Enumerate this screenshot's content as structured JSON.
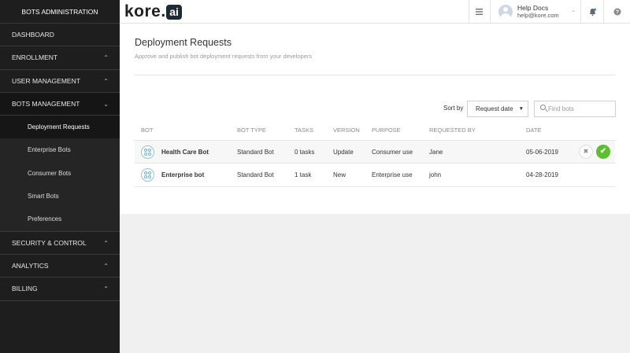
{
  "sidebar": {
    "title": "BOTS ADMINISTRATION",
    "items": [
      {
        "label": "DASHBOARD",
        "chevron": ""
      },
      {
        "label": "ENROLLMENT",
        "chevron": "^"
      },
      {
        "label": "USER MANAGEMENT",
        "chevron": "^"
      },
      {
        "label": "BOTS MANAGEMENT",
        "chevron": "v"
      },
      {
        "label": "SECURITY & CONTROL",
        "chevron": "^"
      },
      {
        "label": "ANALYTICS",
        "chevron": "^"
      },
      {
        "label": "BILLING",
        "chevron": "^"
      }
    ],
    "subitems": [
      {
        "label": "Deployment Requests"
      },
      {
        "label": "Enterprise Bots"
      },
      {
        "label": "Consumer Bots"
      },
      {
        "label": "Smart Bots"
      },
      {
        "label": "Preferences"
      }
    ]
  },
  "topbar": {
    "logo_text": "kore",
    "logo_dot": ".",
    "logo_badge": "ai",
    "menu_icon": "hamburger-icon",
    "user_name": "Help Docs",
    "user_email": "help@kore.com",
    "caret": "⌄",
    "bell_icon": "bell-icon",
    "help_icon": "question-icon"
  },
  "main": {
    "title": "Deployment Requests",
    "subtitle": "Approve and publish bot deployment requests from your developers",
    "sort_label": "Sort by",
    "sort_value": "Request date",
    "search_placeholder": "Find bots",
    "columns": [
      "BOT",
      "BOT TYPE",
      "TASKS",
      "VERSION",
      "PURPOSE",
      "REQUESTED BY",
      "DATE"
    ],
    "rows": [
      {
        "name": "Health Care Bot",
        "type": "Standard Bot",
        "tasks": "0 tasks",
        "version": "Update",
        "purpose": "Consumer use",
        "requested_by": "Jane",
        "date": "05-06-2019"
      },
      {
        "name": "Enterprise bot",
        "type": "Standard Bot",
        "tasks": "1 task",
        "version": "New",
        "purpose": "Enterprise use",
        "requested_by": "john",
        "date": "04-28-2019"
      }
    ],
    "reject_glyph": "✖",
    "approve_glyph": "✔"
  },
  "colors": {
    "sidebar_bg": "#1e1e1e",
    "approve": "#5bbf2f",
    "accent": "#8cc4d6"
  }
}
